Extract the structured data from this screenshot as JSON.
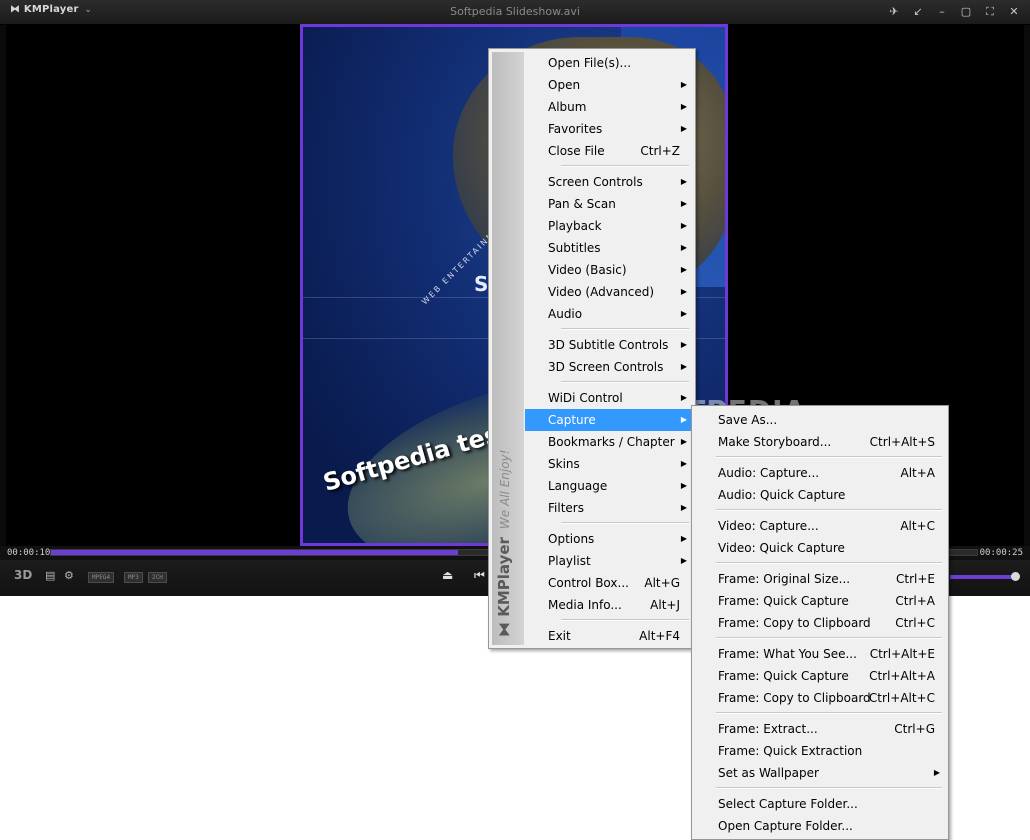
{
  "window": {
    "app_name": "KMPlayer",
    "title": "Softpedia Slideshow.avi",
    "caption_text": "Softpedia test",
    "watermark": "SOFTPEDIA"
  },
  "player": {
    "time_elapsed": "00:00:10",
    "time_total": "00:00:25",
    "progress_fraction": 0.44,
    "volume_fraction": 1.0,
    "codec_tags": [
      "MPEG4",
      "MP3",
      "2CH"
    ],
    "three_d_label": "3D"
  },
  "main_menu": {
    "strip_brand": "KMPlayer",
    "strip_tagline": "We All Enjoy!",
    "items": [
      {
        "label": "Open File(s)...",
        "shortcut": "",
        "submenu": false
      },
      {
        "label": "Open",
        "shortcut": "",
        "submenu": true
      },
      {
        "label": "Album",
        "shortcut": "",
        "submenu": true
      },
      {
        "label": "Favorites",
        "shortcut": "",
        "submenu": true
      },
      {
        "label": "Close File",
        "shortcut": "Ctrl+Z",
        "submenu": false
      },
      {
        "label": "Screen Controls",
        "shortcut": "",
        "submenu": true
      },
      {
        "label": "Pan & Scan",
        "shortcut": "",
        "submenu": true
      },
      {
        "label": "Playback",
        "shortcut": "",
        "submenu": true
      },
      {
        "label": "Subtitles",
        "shortcut": "",
        "submenu": true
      },
      {
        "label": "Video (Basic)",
        "shortcut": "",
        "submenu": true
      },
      {
        "label": "Video (Advanced)",
        "shortcut": "",
        "submenu": true
      },
      {
        "label": "Audio",
        "shortcut": "",
        "submenu": true
      },
      {
        "label": "3D Subtitle Controls",
        "shortcut": "",
        "submenu": true
      },
      {
        "label": "3D Screen Controls",
        "shortcut": "",
        "submenu": true
      },
      {
        "label": "WiDi Control",
        "shortcut": "",
        "submenu": true
      },
      {
        "label": "Capture",
        "shortcut": "",
        "submenu": true,
        "highlighted": true
      },
      {
        "label": "Bookmarks / Chapter",
        "shortcut": "",
        "submenu": true
      },
      {
        "label": "Skins",
        "shortcut": "",
        "submenu": true
      },
      {
        "label": "Language",
        "shortcut": "",
        "submenu": true
      },
      {
        "label": "Filters",
        "shortcut": "",
        "submenu": true
      },
      {
        "label": "Options",
        "shortcut": "",
        "submenu": true
      },
      {
        "label": "Playlist",
        "shortcut": "",
        "submenu": true
      },
      {
        "label": "Control Box...",
        "shortcut": "Alt+G",
        "submenu": false
      },
      {
        "label": "Media Info...",
        "shortcut": "Alt+J",
        "submenu": false
      },
      {
        "label": "Exit",
        "shortcut": "Alt+F4",
        "submenu": false
      }
    ]
  },
  "capture_menu": {
    "items": [
      {
        "label": "Save As...",
        "shortcut": "",
        "submenu": false
      },
      {
        "label": "Make Storyboard...",
        "shortcut": "Ctrl+Alt+S",
        "submenu": false
      },
      {
        "label": "Audio: Capture...",
        "shortcut": "Alt+A",
        "submenu": false
      },
      {
        "label": "Audio: Quick Capture",
        "shortcut": "",
        "submenu": false
      },
      {
        "label": "Video: Capture...",
        "shortcut": "Alt+C",
        "submenu": false
      },
      {
        "label": "Video: Quick Capture",
        "shortcut": "",
        "submenu": false
      },
      {
        "label": "Frame: Original Size...",
        "shortcut": "Ctrl+E",
        "submenu": false
      },
      {
        "label": "Frame: Quick Capture",
        "shortcut": "Ctrl+A",
        "submenu": false
      },
      {
        "label": "Frame: Copy to Clipboard",
        "shortcut": "Ctrl+C",
        "submenu": false
      },
      {
        "label": "Frame: What You See...",
        "shortcut": "Ctrl+Alt+E",
        "submenu": false
      },
      {
        "label": "Frame: Quick Capture",
        "shortcut": "Ctrl+Alt+A",
        "submenu": false
      },
      {
        "label": "Frame: Copy to Clipboard",
        "shortcut": "Ctrl+Alt+C",
        "submenu": false
      },
      {
        "label": "Frame: Extract...",
        "shortcut": "Ctrl+G",
        "submenu": false
      },
      {
        "label": "Frame: Quick Extraction",
        "shortcut": "",
        "submenu": false
      },
      {
        "label": "Set as Wallpaper",
        "shortcut": "",
        "submenu": true
      },
      {
        "label": "Select Capture Folder...",
        "shortcut": "",
        "submenu": false
      },
      {
        "label": "Open Capture Folder...",
        "shortcut": "",
        "submenu": false
      }
    ]
  },
  "colors": {
    "accent": "#6c3fd4",
    "menu_highlight": "#3399ff",
    "menu_bg": "#f0f0f0"
  }
}
